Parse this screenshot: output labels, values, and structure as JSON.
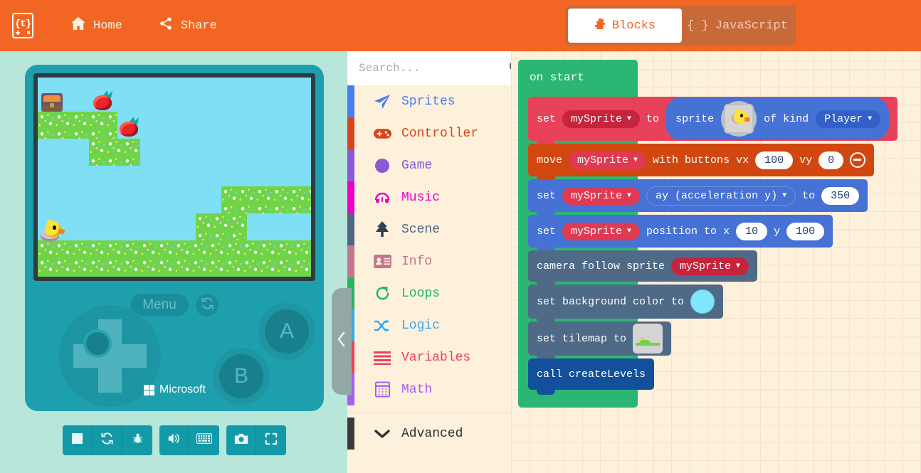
{
  "header": {
    "logo_icon": "makecode-arcade-logo",
    "home_label": "Home",
    "home_icon": "home-icon",
    "share_label": "Share",
    "share_icon": "share-icon",
    "tabs": [
      {
        "label": "Blocks",
        "icon": "puzzle-piece-icon",
        "active": true
      },
      {
        "label": "JavaScript",
        "icon": "curly-braces-icon",
        "active": false
      }
    ],
    "brand_color": "#f26522"
  },
  "simulator": {
    "menu_label": "Menu",
    "sync_icon": "refresh-icon",
    "button_a_label": "A",
    "button_b_label": "B",
    "brand_label": "Microsoft",
    "screen_bg_color": "#7fe0f5",
    "case_color": "#1e9fae",
    "toolbar": [
      {
        "name": "stop-button",
        "icon": "stop-square-icon"
      },
      {
        "name": "restart-button",
        "icon": "refresh-icon"
      },
      {
        "name": "debug-button",
        "icon": "bug-icon"
      },
      {
        "name": "mute-button",
        "icon": "speaker-icon"
      },
      {
        "name": "keyboard-button",
        "icon": "keyboard-icon"
      },
      {
        "name": "screenshot-button",
        "icon": "camera-icon"
      },
      {
        "name": "fullscreen-button",
        "icon": "fullscreen-icon"
      }
    ]
  },
  "toolbox": {
    "search_placeholder": "Search...",
    "search_value": "",
    "search_icon": "search-icon",
    "collapse_icon": "chevron-left-icon",
    "categories": [
      {
        "label": "Sprites",
        "color": "#4a7ef0",
        "icon": "paper-plane-icon"
      },
      {
        "label": "Controller",
        "color": "#d9441a",
        "icon": "gamepad-icon"
      },
      {
        "label": "Game",
        "color": "#8a5ad6",
        "icon": "circle-icon"
      },
      {
        "label": "Music",
        "color": "#ec00c8",
        "icon": "headphones-icon"
      },
      {
        "label": "Scene",
        "color": "#4c6781",
        "icon": "tree-icon"
      },
      {
        "label": "Info",
        "color": "#c2758c",
        "icon": "id-card-icon"
      },
      {
        "label": "Loops",
        "color": "#25b563",
        "icon": "loop-arrow-icon"
      },
      {
        "label": "Logic",
        "color": "#3ca5e8",
        "icon": "shuffle-icon"
      },
      {
        "label": "Variables",
        "color": "#ee4056",
        "icon": "lines-icon"
      },
      {
        "label": "Math",
        "color": "#a45ff0",
        "icon": "calculator-icon"
      }
    ],
    "advanced_label": "Advanced",
    "advanced_icon": "chevron-down-icon"
  },
  "workspace": {
    "on_start_label": "on start",
    "blocks": {
      "set_sprite": {
        "set_label": "set",
        "variable": "mySprite",
        "to_label": "to",
        "sprite_label": "sprite",
        "sprite_image": "duck-sprite-thumbnail",
        "of_kind_label": "of kind",
        "kind": "Player"
      },
      "move_with_buttons": {
        "move_label": "move",
        "variable": "mySprite",
        "with_buttons_label": "with buttons",
        "vx_label": "vx",
        "vx": "100",
        "vy_label": "vy",
        "vy": "0",
        "minus_icon": "minus-circle-icon"
      },
      "set_acceleration": {
        "set_label": "set",
        "variable": "mySprite",
        "property": "ay (acceleration y)",
        "to_label": "to",
        "value": "350"
      },
      "set_position": {
        "set_label": "set",
        "variable": "mySprite",
        "position_label": "position to x",
        "x": "10",
        "y_label": "y",
        "y": "100"
      },
      "camera_follow": {
        "label": "camera follow sprite",
        "variable": "mySprite"
      },
      "set_background_color": {
        "label": "set background color to",
        "color": "#7fe6fb"
      },
      "set_tilemap": {
        "label": "set tilemap to",
        "tilemap_image": "tilemap-thumbnail"
      },
      "call_function": {
        "label": "call createLevels"
      }
    }
  }
}
